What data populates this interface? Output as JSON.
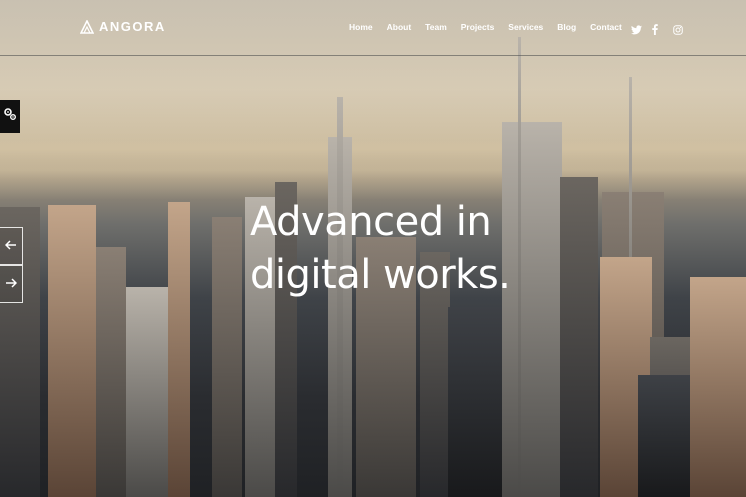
{
  "brand": {
    "name": "ANGORA",
    "logo_icon": "angora-logo-icon"
  },
  "nav": {
    "items": [
      "Home",
      "About",
      "Team",
      "Projects",
      "Services",
      "Blog",
      "Contact"
    ]
  },
  "social": {
    "icons": [
      "twitter-icon",
      "facebook-icon",
      "instagram-icon"
    ]
  },
  "slider": {
    "headline_line1": "Advanced in",
    "headline_line2": "digital works.",
    "prev_icon": "arrow-left-icon",
    "next_icon": "arrow-right-icon"
  },
  "widgets": {
    "settings_icon": "gears-icon"
  },
  "colors": {
    "text": "#ffffff",
    "settings_tab": "#111111"
  }
}
